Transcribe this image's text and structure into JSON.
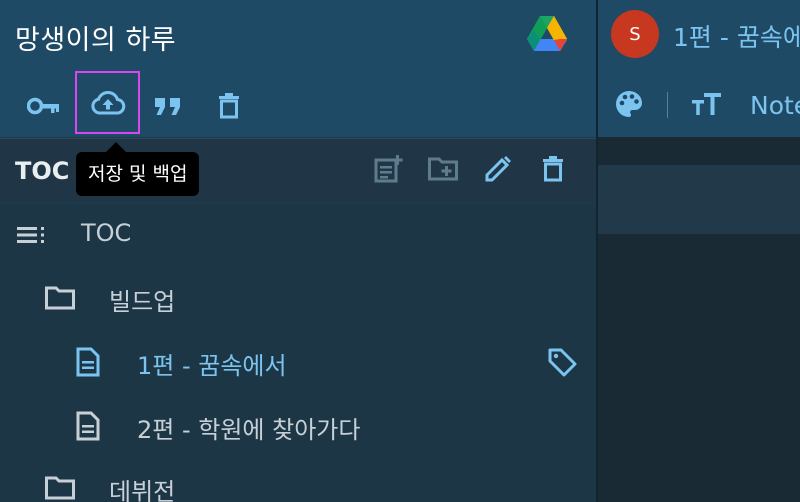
{
  "app": {
    "title": "망생이의 하루"
  },
  "toolbar": {
    "items": [
      {
        "name": "key-icon"
      },
      {
        "name": "cloud-upload-icon"
      },
      {
        "name": "quote-icon"
      },
      {
        "name": "trash-icon"
      }
    ],
    "tooltip": "저장 및 백업"
  },
  "toc_panel": {
    "title": "TOC",
    "actions": [
      "note-add-icon",
      "folder-add-icon",
      "pencil-icon",
      "trash-icon"
    ]
  },
  "tree": {
    "items": [
      {
        "label": "TOC",
        "icon": "list-icon",
        "level": 0
      },
      {
        "label": "빌드업",
        "icon": "folder-icon",
        "level": 1
      },
      {
        "label": "1편 - 꿈속에서",
        "icon": "document-icon",
        "level": 2,
        "active": true,
        "tagged": true
      },
      {
        "label": "2편 - 학원에 찾아가다",
        "icon": "document-icon",
        "level": 2
      },
      {
        "label": "데뷔전",
        "icon": "folder-icon",
        "level": 1
      }
    ]
  },
  "editor": {
    "avatar_initial": "S",
    "note_title": "1편 - 꿈속에",
    "tools": [
      "palette-icon",
      "text-size-icon"
    ],
    "note_label": "Note"
  },
  "colors": {
    "header": "#1e4a66",
    "accent_text": "#7cc4f0",
    "highlight": "#d946ef",
    "avatar": "#c8371f"
  }
}
